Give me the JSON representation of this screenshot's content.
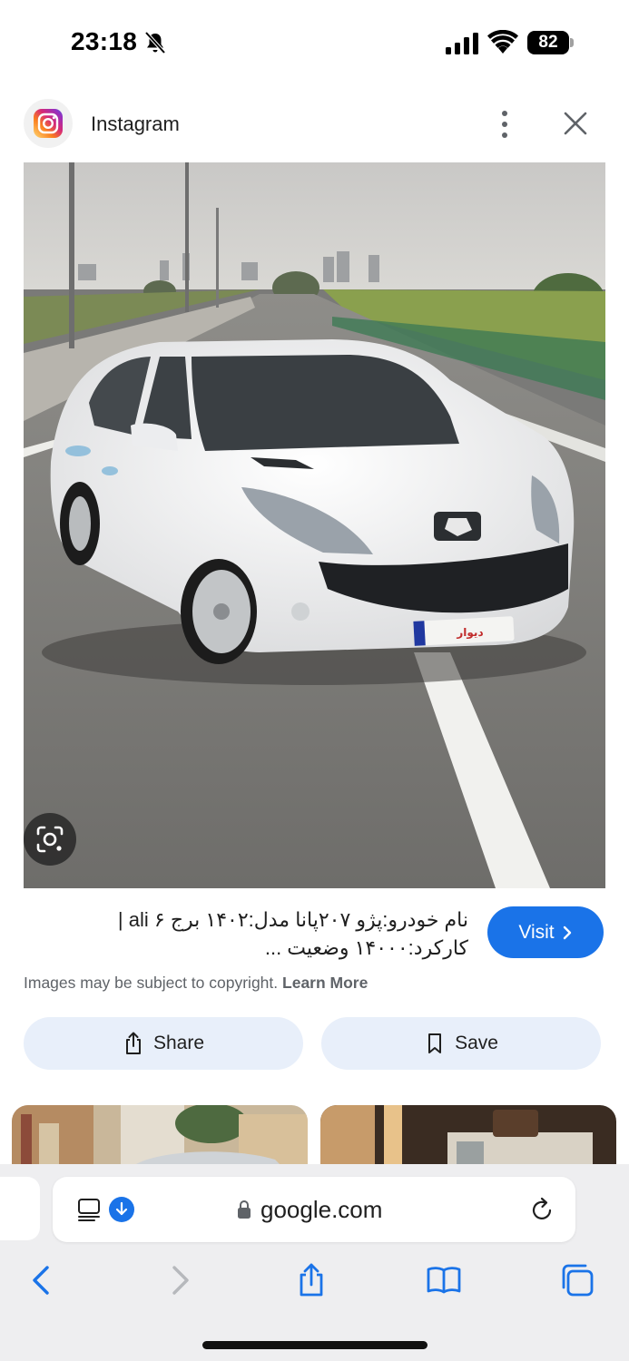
{
  "status_bar": {
    "time": "23:18",
    "battery": "82",
    "icons": [
      "bell-slash-icon",
      "cellular-signal-icon",
      "wifi-icon",
      "battery-icon"
    ]
  },
  "source": {
    "name": "Instagram",
    "icon": "instagram-logo",
    "actions": [
      "more-vert-icon",
      "close-icon"
    ]
  },
  "image": {
    "description_icon": "visual-search-lens-icon",
    "plate_text": "دیوار"
  },
  "caption": {
    "line1": "نام خودرو:پژو ۲۰۷پانا مدل:۱۴۰۲ برج ۶ ali |",
    "line2": "کارکرد:۱۴۰۰۰ وضعیت ..."
  },
  "visit": {
    "label": "Visit"
  },
  "copyright": {
    "text": "Images may be subject to copyright.",
    "link": "Learn More"
  },
  "actions": {
    "share_label": "Share",
    "save_label": "Save"
  },
  "browser": {
    "url": "google.com",
    "toolbar": [
      "back-icon",
      "forward-icon",
      "share-icon",
      "bookmarks-icon",
      "tabs-icon"
    ]
  },
  "colors": {
    "accent": "#1a73e8",
    "pill_bg": "#e8effa",
    "secondary_text": "#5f6368"
  }
}
